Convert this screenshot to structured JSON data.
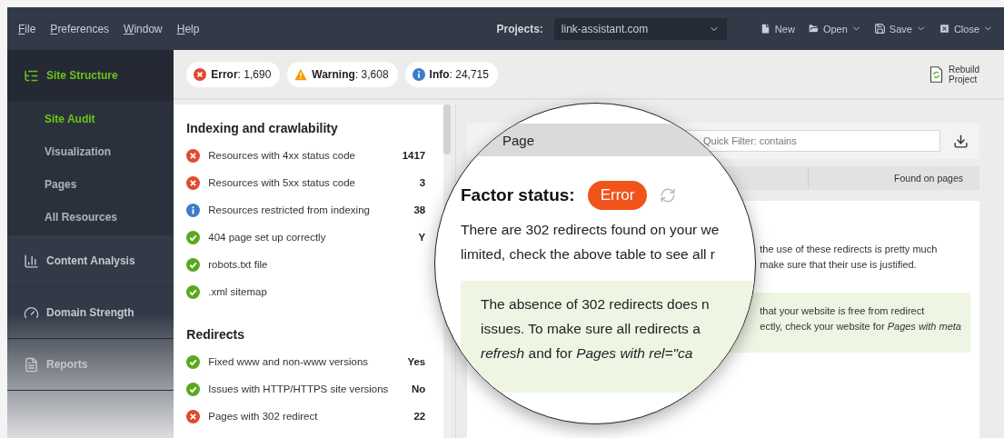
{
  "menu": [
    "File",
    "Preferences",
    "Window",
    "Help"
  ],
  "projects": {
    "label": "Projects:",
    "value": "link-assistant.com"
  },
  "toolbar": [
    {
      "kind": "new",
      "label": "New",
      "dropdown": false
    },
    {
      "kind": "open",
      "label": "Open",
      "dropdown": true
    },
    {
      "kind": "save",
      "label": "Save",
      "dropdown": true
    },
    {
      "kind": "close",
      "label": "Close",
      "dropdown": true
    }
  ],
  "sidebar": [
    {
      "kind": "structure",
      "label": "Site Structure",
      "selected": true,
      "children": [
        {
          "label": "Site Audit",
          "selected": true
        },
        {
          "label": "Visualization",
          "selected": false
        },
        {
          "label": "Pages",
          "selected": false
        },
        {
          "label": "All Resources",
          "selected": false
        }
      ]
    },
    {
      "kind": "content",
      "label": "Content Analysis",
      "selected": false
    },
    {
      "kind": "domain",
      "label": "Domain Strength",
      "selected": false
    },
    {
      "kind": "reports",
      "label": "Reports",
      "selected": false
    }
  ],
  "summary": [
    {
      "kind": "error",
      "text": "**Error**: 1,690"
    },
    {
      "kind": "warning",
      "text": "**Warning**: 3,608"
    },
    {
      "kind": "info",
      "text": "**Info**: 24,715"
    }
  ],
  "rebuild": {
    "label": "Rebuild Project"
  },
  "factors": [
    {
      "heading": "Indexing and crawlability",
      "items": [
        {
          "kind": "error",
          "label": "Resources with 4xx status code",
          "value": "1417"
        },
        {
          "kind": "error",
          "label": "Resources with 5xx status code",
          "value": "3"
        },
        {
          "kind": "info",
          "label": "Resources restricted from indexing",
          "value": "38"
        },
        {
          "kind": "ok",
          "label": "404 page set up correctly",
          "value": "Y"
        },
        {
          "kind": "ok",
          "label": "robots.txt file"
        },
        {
          "kind": "ok",
          "label": ".xml sitemap"
        }
      ]
    },
    {
      "heading": "Redirects",
      "items": [
        {
          "kind": "ok",
          "label": "Fixed www and non-www versions",
          "value": "Yes"
        },
        {
          "kind": "ok",
          "label": "Issues with HTTP/HTTPS site versions",
          "value": "No"
        },
        {
          "kind": "error",
          "label": "Pages with 302 redirect",
          "value": "22"
        }
      ]
    }
  ],
  "table": {
    "filter_placeholder": "Quick Filter: contains",
    "columns": [
      "Found on pages"
    ]
  },
  "details": {
    "text": [
      "the use of these redirects is pretty much",
      "make sure that their use is justified."
    ],
    "tip": [
      "that your website is free from redirect",
      "ectly, check your website for *Pages with meta*"
    ]
  },
  "magnifier": {
    "column": "Page",
    "factor_label": "Factor status:",
    "status": {
      "kind": "error",
      "label": "Error"
    },
    "text": [
      "There are 302 redirects found on your we",
      "limited, check the above table to see all r"
    ],
    "tip": [
      "The absence of 302 redirects does n",
      "issues. To make sure all redirects a",
      "*refresh* and for *Pages with rel=\"ca*"
    ]
  }
}
